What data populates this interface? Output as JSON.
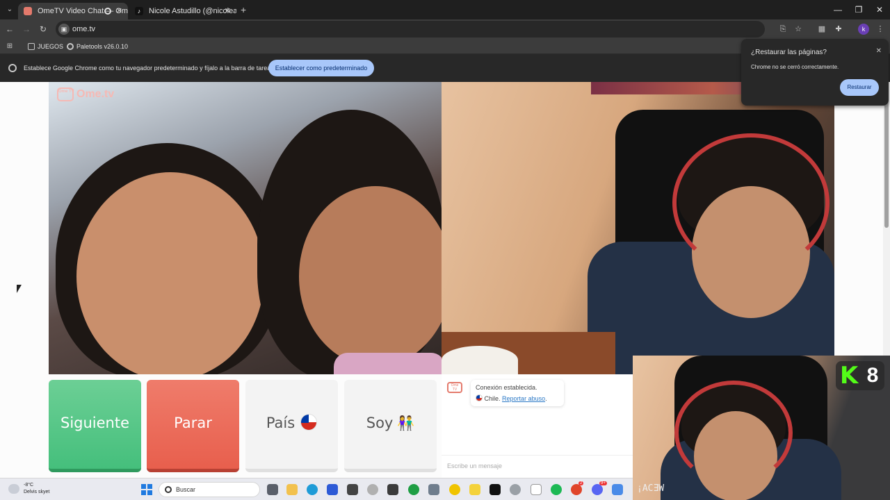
{
  "browser": {
    "tabs": [
      {
        "title": "OmeTV Video Chat — Ome",
        "active": true
      },
      {
        "title": "Nicole Astudillo (@nicoleastud",
        "active": false
      }
    ],
    "new_tab": "+",
    "url": "ome.tv",
    "profile_initial": "k",
    "bookmarks": [
      {
        "label": "JUEGOS",
        "icon": "folder-icon"
      },
      {
        "label": "Paletools v26.0.10",
        "icon": "globe-icon"
      }
    ],
    "infobar": {
      "message": "Establece Google Chrome como tu navegador predeterminado y fíjalo a la barra de tareas",
      "button": "Establecer como predeterminado"
    },
    "restore_popup": {
      "title": "¿Restaurar las páginas?",
      "body": "Chrome no se cerró correctamente.",
      "button": "Restaurar"
    }
  },
  "page": {
    "logo": "Ome.tv",
    "logo_icon_text": "Ome TV",
    "buttons": {
      "next": "Siguiente",
      "stop": "Parar",
      "country": "País",
      "gender": "Soy"
    },
    "chat": {
      "status": "Conexión establecida.",
      "country": "Chile.",
      "report": "Reportar abuso",
      "input_placeholder": "Escribe un mensaje"
    }
  },
  "overlay": {
    "kick_logo": "K",
    "viewer_count": "8",
    "watermark": "¡ACƎW"
  },
  "taskbar": {
    "weather_temp": "-8°C",
    "weather_desc": "Delvis skyet",
    "search": "Buscar",
    "badges": [
      "2",
      "9+"
    ]
  },
  "colors": {
    "next": "#45bf7c",
    "stop": "#e85f4d",
    "chrome_dark": "#3c3c3c",
    "accent_button": "#a8c7fa"
  }
}
